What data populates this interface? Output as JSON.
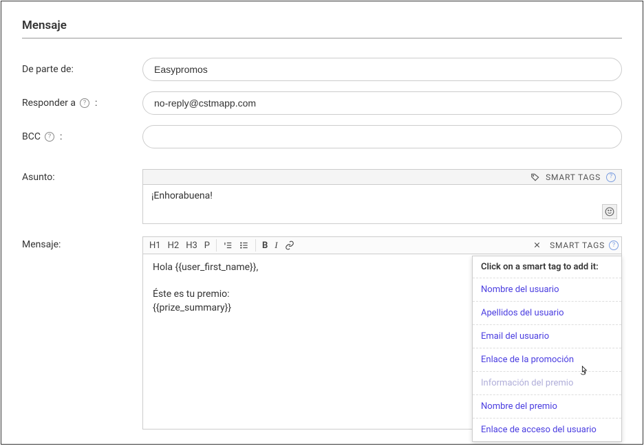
{
  "section_title": "Mensaje",
  "labels": {
    "from": "De parte de:",
    "reply_to": "Responder a",
    "bcc": "BCC",
    "subject": "Asunto:",
    "message": "Mensaje:"
  },
  "fields": {
    "from_value": "Easypromos",
    "reply_to_value": "no-reply@cstmapp.com",
    "bcc_value": ""
  },
  "subject": {
    "smart_tags_label": "SMART TAGS",
    "value": "¡Enhorabuena!"
  },
  "toolbar": {
    "h1": "H1",
    "h2": "H2",
    "h3": "H3",
    "p": "P",
    "b": "B",
    "i": "I",
    "smart_tags_label": "SMART TAGS"
  },
  "editor_content": "Hola {{user_first_name}},\n\nÉste es tu premio:\n{{prize_summary}}",
  "dropdown": {
    "header": "Click on a smart tag to add it:",
    "items": [
      "Nombre del usuario",
      "Apellidos del usuario",
      "Email del usuario",
      "Enlace de la promoción",
      "Información del premio",
      "Nombre del premio",
      "Enlace de acceso del usuario"
    ],
    "hovered_index": 4
  }
}
